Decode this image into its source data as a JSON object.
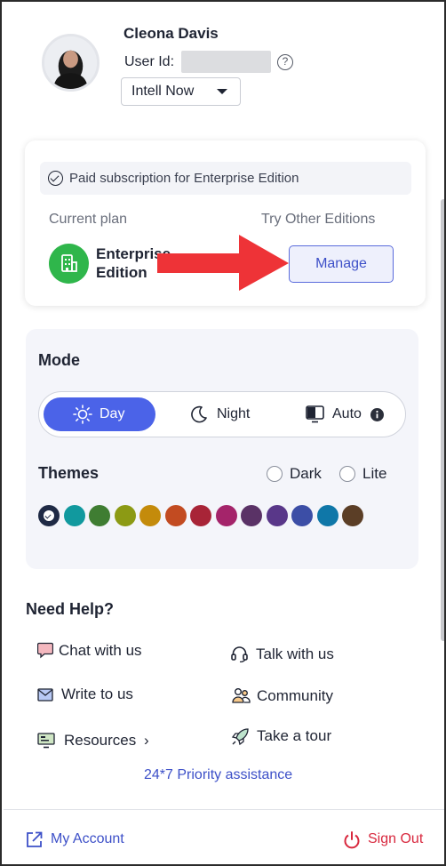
{
  "user": {
    "name": "Cleona Davis",
    "user_id_label": "User Id:",
    "org": "Intell Now"
  },
  "plan": {
    "subscription_text": "Paid subscription for Enterprise Edition",
    "current_plan_label": "Current plan",
    "try_other_label": "Try Other Editions",
    "edition_line1": "Enterprise",
    "edition_line2": "Edition",
    "manage_label": "Manage"
  },
  "mode": {
    "title": "Mode",
    "options": [
      "Day",
      "Night",
      "Auto"
    ],
    "selected": "Day"
  },
  "themes": {
    "title": "Themes",
    "radio_options": [
      "Dark",
      "Lite"
    ],
    "swatches": [
      "#1f2a45",
      "#11999e",
      "#3f7d32",
      "#8c9a14",
      "#c48b0b",
      "#c24b21",
      "#a82437",
      "#a4246a",
      "#5a3266",
      "#593789",
      "#3c4ea6",
      "#0f77a8",
      "#5b3e26"
    ],
    "selected_index": 0
  },
  "help": {
    "title": "Need Help?",
    "items": [
      {
        "label": "Chat with us",
        "icon": "chat-icon"
      },
      {
        "label": "Talk with us",
        "icon": "headset-icon"
      },
      {
        "label": "Write to us",
        "icon": "mail-icon"
      },
      {
        "label": "Community",
        "icon": "community-icon"
      },
      {
        "label": "Resources",
        "icon": "resources-icon"
      },
      {
        "label": "Take a tour",
        "icon": "rocket-icon"
      }
    ],
    "priority_link": "24*7 Priority assistance"
  },
  "footer": {
    "my_account": "My Account",
    "sign_out": "Sign Out"
  },
  "colors": {
    "accent": "#4b63e8",
    "link": "#3d50c8",
    "edition_green": "#2fb64b",
    "sign_out_red": "#d8283e",
    "arrow_red": "#ee3337"
  }
}
